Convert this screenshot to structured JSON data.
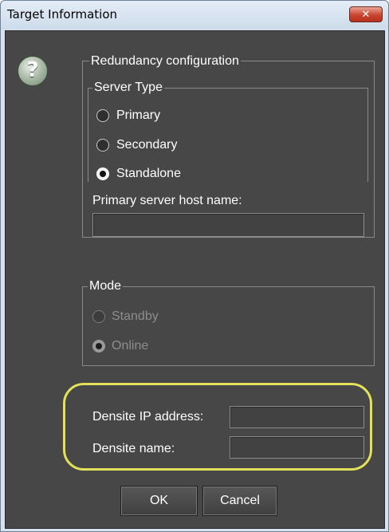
{
  "window": {
    "title": "Target Information",
    "close_label": "✕"
  },
  "redundancy": {
    "title": "Redundancy configuration",
    "server_type": {
      "title": "Server Type",
      "options": [
        "Primary",
        "Secondary",
        "Standalone"
      ],
      "selected": "Standalone"
    },
    "primary_host_label": "Primary server host name:",
    "primary_host_value": ""
  },
  "mode": {
    "title": "Mode",
    "options": [
      "Standby",
      "Online"
    ],
    "selected": "Online",
    "enabled": false
  },
  "densite": {
    "ip_label": "Densite IP address:",
    "ip_value": "",
    "name_label": "Densite name:",
    "name_value": ""
  },
  "buttons": {
    "ok": "OK",
    "cancel": "Cancel"
  },
  "colors": {
    "panel_bg": "#474747",
    "highlight": "#e3e05a",
    "close_button": "#c9452f"
  }
}
